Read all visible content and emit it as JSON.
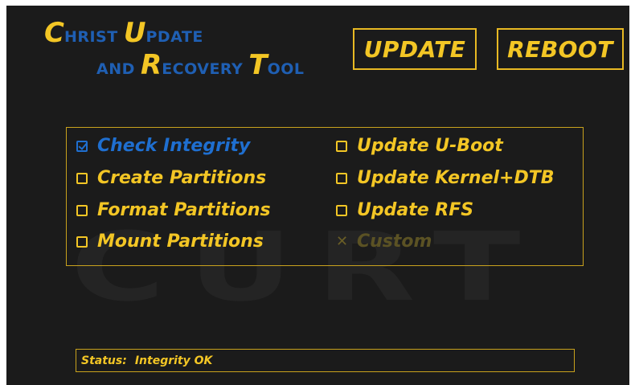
{
  "watermark": "CURT",
  "title": {
    "line1": [
      {
        "text": "C",
        "style": "big"
      },
      {
        "text": "HRIST ",
        "style": "sm"
      },
      {
        "text": "U",
        "style": "big"
      },
      {
        "text": "PDATE",
        "style": "sm"
      }
    ],
    "line2": [
      {
        "text": "AND ",
        "style": "sm"
      },
      {
        "text": "R",
        "style": "big"
      },
      {
        "text": "ECOVERY ",
        "style": "sm"
      },
      {
        "text": "T",
        "style": "big"
      },
      {
        "text": "OOL",
        "style": "sm"
      }
    ]
  },
  "buttons": {
    "update": "UPDATE",
    "reboot": "REBOOT"
  },
  "options": {
    "check_integrity": {
      "label": "Check Integrity",
      "checked": true
    },
    "create_partitions": {
      "label": "Create Partitions",
      "checked": false
    },
    "format_partitions": {
      "label": "Format Partitions",
      "checked": false
    },
    "mount_partitions": {
      "label": "Mount Partitions",
      "checked": false
    },
    "update_uboot": {
      "label": "Update U-Boot",
      "checked": false
    },
    "update_kernel": {
      "label": "Update Kernel+DTB",
      "checked": false
    },
    "update_rfs": {
      "label": "Update RFS",
      "checked": false
    },
    "custom": {
      "label": "Custom",
      "checked": false,
      "disabled": true
    }
  },
  "status": {
    "label": "Status:",
    "value": "Integrity OK"
  },
  "colors": {
    "background": "#1b1b1b",
    "accent_yellow": "#f3c625",
    "accent_blue": "#1f6fd0",
    "disabled": "#5b5224"
  }
}
